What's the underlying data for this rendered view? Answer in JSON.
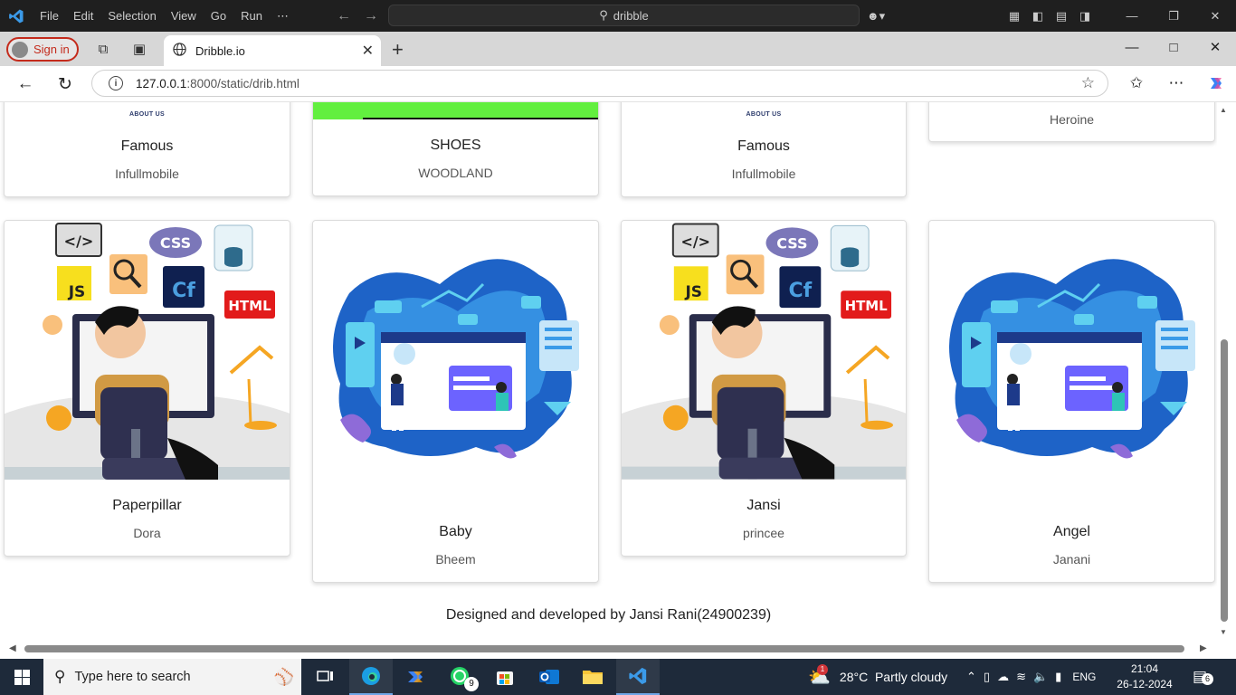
{
  "vscode": {
    "menu": [
      "File",
      "Edit",
      "Selection",
      "View",
      "Go",
      "Run",
      "⋯"
    ],
    "search": "dribble"
  },
  "browser": {
    "sign_in": "Sign in",
    "tab_title": "Dribble.io",
    "url_host": "127.0.0.1",
    "url_path": ":8000/static/drib.html"
  },
  "page": {
    "top_cards": [
      {
        "caption": "ABOUT US",
        "title": "Famous",
        "subtitle": "Infullmobile"
      },
      {
        "title": "SHOES",
        "subtitle": "WOODLAND"
      },
      {
        "caption": "ABOUT US",
        "title": "Famous",
        "subtitle": "Infullmobile"
      },
      {
        "subtitle": "Heroine"
      }
    ],
    "cards": [
      {
        "title": "Paperpillar",
        "subtitle": "Dora",
        "image": "developer-illustration"
      },
      {
        "title": "Baby",
        "subtitle": "Bheem",
        "image": "web-design-illustration"
      },
      {
        "title": "Jansi",
        "subtitle": "princee",
        "image": "developer-illustration"
      },
      {
        "title": "Angel",
        "subtitle": "Janani",
        "image": "web-design-illustration"
      }
    ],
    "footer": "Designed and developed by Jansi Rani(24900239)"
  },
  "taskbar": {
    "search_placeholder": "Type here to search",
    "weather": "28°C  Partly cloudy",
    "lang": "ENG",
    "time": "21:04",
    "date": "26-12-2024",
    "whatsapp_badge": "9",
    "weather_badge": "1",
    "notifications": "6"
  },
  "colors": {
    "accent_green": "#62ef3f",
    "edge_red": "#c42b1c",
    "taskbar": "#1e2a3a"
  }
}
